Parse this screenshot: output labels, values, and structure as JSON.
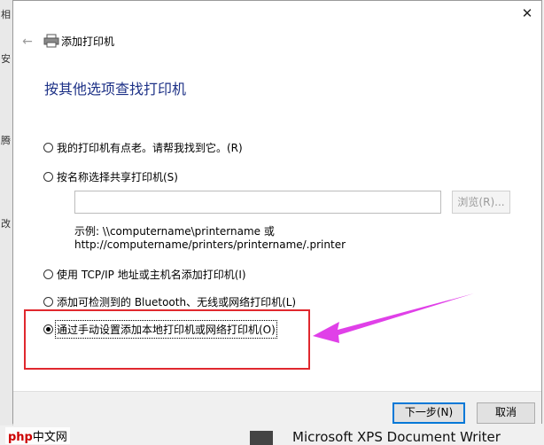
{
  "background": {
    "side_chars": [
      "相",
      "安",
      "腾",
      "改"
    ],
    "printer_entry": "Microsoft XPS Document Writer"
  },
  "watermark": {
    "brand": "php",
    "site": "中文网"
  },
  "dialog": {
    "close_label": "✕",
    "back_label": "←",
    "title": "添加打印机",
    "heading": "按其他选项查找打印机",
    "options": [
      {
        "label": "我的打印机有点老。请帮我找到它。(R)",
        "checked": false
      },
      {
        "label": "按名称选择共享打印机(S)",
        "checked": false
      },
      {
        "label": "使用 TCP/IP 地址或主机名添加打印机(I)",
        "checked": false
      },
      {
        "label": "添加可检测到的 Bluetooth、无线或网络打印机(L)",
        "checked": false
      },
      {
        "label": "通过手动设置添加本地打印机或网络打印机(O)",
        "checked": true
      }
    ],
    "share_input_value": "",
    "browse_label": "浏览(R)...",
    "example_line1": "示例: \\\\computername\\printername 或",
    "example_line2": "http://computername/printers/printername/.printer",
    "next_label": "下一步(N)",
    "cancel_label": "取消"
  },
  "colors": {
    "heading": "#1e3287",
    "annotation": "#e0282e",
    "arrow": "#e040e8",
    "primary_border": "#0078d7"
  }
}
